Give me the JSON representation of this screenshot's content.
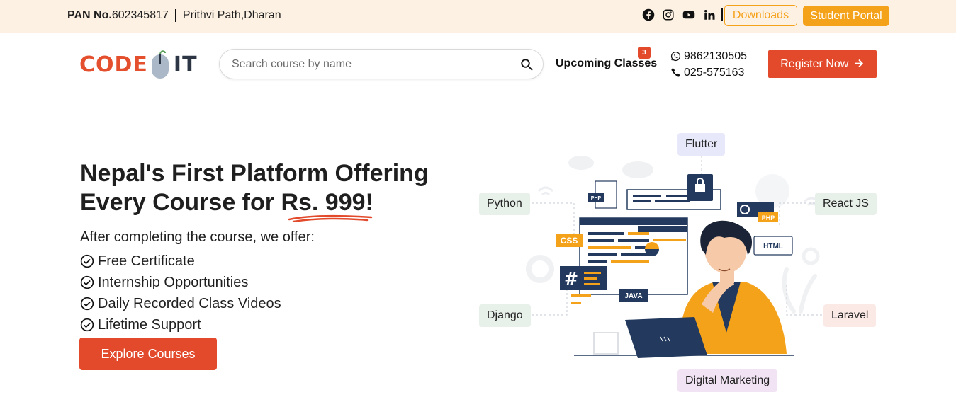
{
  "topbar": {
    "pan_label": "PAN No.",
    "pan_number": "602345817",
    "address": "Prithvi Path,Dharan",
    "social_icons": [
      "facebook-icon",
      "instagram-icon",
      "youtube-icon",
      "linkedin-icon"
    ],
    "downloads_label": "Downloads",
    "student_portal_label": "Student Portal"
  },
  "header": {
    "logo_code": "CODE",
    "logo_it": "IT",
    "search_placeholder": "Search course by name",
    "upcoming_label": "Upcoming Classes",
    "upcoming_count": "3",
    "whatsapp_number": "9862130505",
    "phone_number": "025-575163",
    "register_label": "Register Now"
  },
  "hero": {
    "title_line1": "Nepal's First Platform Offering",
    "title_line2_prefix": "Every Course for ",
    "title_price": "Rs. 999!",
    "offer_intro": "After completing the course, we offer:",
    "offers": [
      "Free Certificate",
      "Internship Opportunities",
      "Daily Recorded Class Videos",
      "Lifetime Support"
    ],
    "explore_label": "Explore Courses"
  },
  "illustration": {
    "chips": [
      "Flutter",
      "Python",
      "React JS",
      "Django",
      "Laravel",
      "Digital Marketing"
    ],
    "tags": [
      "PHP",
      "CSS",
      "HTML",
      "JAVA",
      "PHP"
    ]
  },
  "colors": {
    "brand_red": "#e24a2b",
    "brand_orange": "#f5a21b",
    "topbar_bg": "#fdf1e3",
    "navy": "#233a5e"
  }
}
